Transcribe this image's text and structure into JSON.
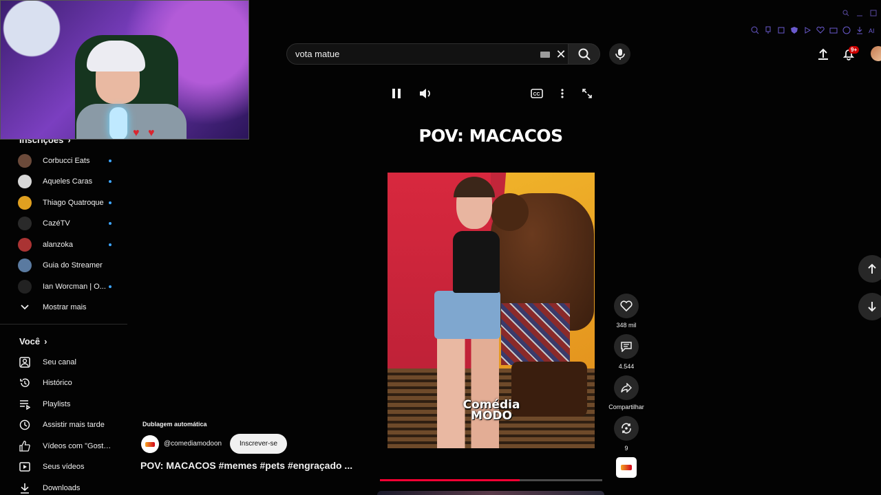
{
  "search": {
    "query": "vota matue",
    "clear_icon": "close-icon",
    "search_icon": "search-icon",
    "voice_icon": "mic-icon"
  },
  "header": {
    "upload_icon": "upload-icon",
    "notifications_icon": "bell-icon",
    "notifications_count": "9+"
  },
  "sidebar": {
    "subscriptions_heading": "Inscrições",
    "subscriptions": [
      {
        "label": "Corbucci Eats",
        "color": "#6b4a3a"
      },
      {
        "label": "Aqueles Caras",
        "color": "#d8d8d8"
      },
      {
        "label": "Thiago Quatroque",
        "color": "#e0a020"
      },
      {
        "label": "CazéTV",
        "color": "#2a2a2a"
      },
      {
        "label": "alanzoka",
        "color": "#a33"
      },
      {
        "label": "Guia do Streamer",
        "color": "#5a7aa0"
      },
      {
        "label": "Ian Worcman | O...",
        "color": "#222"
      }
    ],
    "show_more": "Mostrar mais",
    "you_heading": "Você",
    "you_items": [
      {
        "label": "Seu canal",
        "icon": "user-square-icon"
      },
      {
        "label": "Histórico",
        "icon": "history-icon"
      },
      {
        "label": "Playlists",
        "icon": "playlist-icon"
      },
      {
        "label": "Assistir mais tarde",
        "icon": "clock-icon"
      },
      {
        "label": "Vídeos com \"Gostei\"",
        "icon": "thumbs-up-icon"
      },
      {
        "label": "Seus vídeos",
        "icon": "play-square-icon"
      },
      {
        "label": "Downloads",
        "icon": "download-icon"
      }
    ]
  },
  "player": {
    "title_overlay": "POV: MACACOS",
    "watermark_line1": "Comédia",
    "watermark_line2": "MODO",
    "progress": 0.63
  },
  "actions": {
    "likes": "348 mil",
    "comments": "4.544",
    "share": "Compartilhar",
    "remix": "9"
  },
  "short": {
    "dubbing": "Dublagem automática",
    "channel": "@comediamodoon",
    "subscribe": "Inscrever-se",
    "title": "POV: MACACOS #memes #pets #engraçado ..."
  },
  "colors": {
    "accent": "#ff0033",
    "badge": "#cc0000",
    "link_dot": "#3ea6ff"
  }
}
